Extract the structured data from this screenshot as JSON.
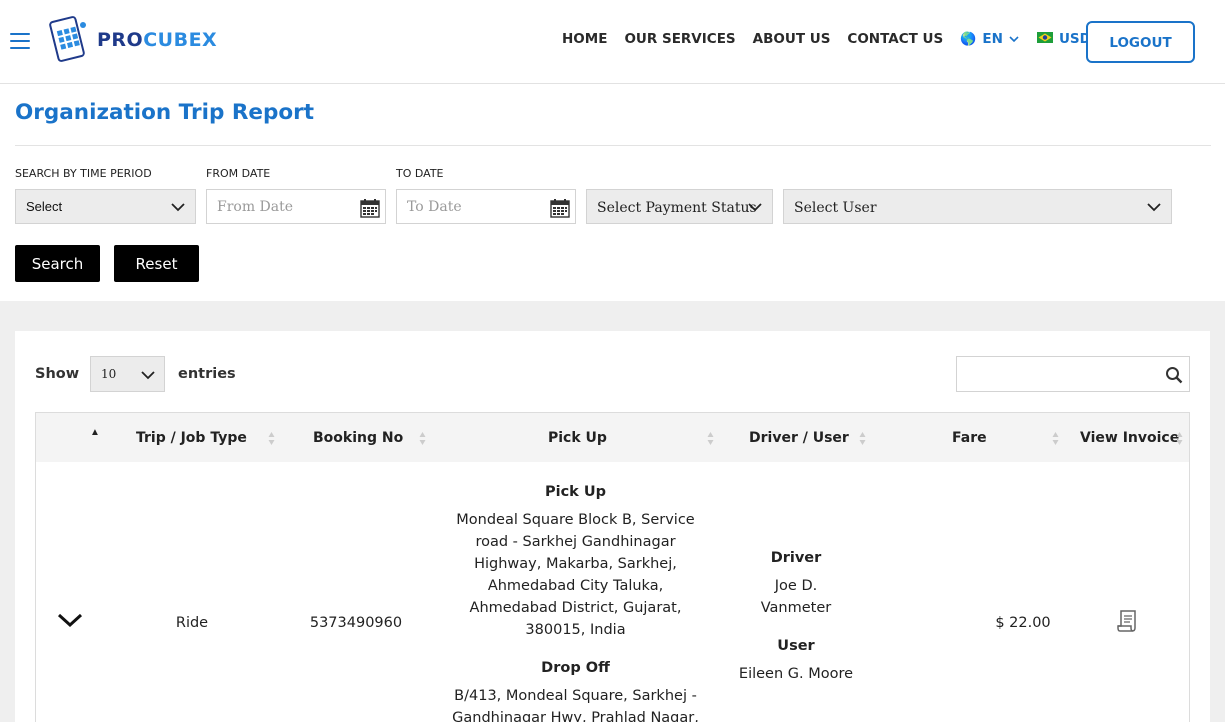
{
  "header": {
    "brand_part1": "PRO",
    "brand_part2": "CUBEX",
    "nav": [
      "HOME",
      "OUR SERVICES",
      "ABOUT US",
      "CONTACT US"
    ],
    "language": "EN",
    "currency": "USD",
    "logout_label": "LOGOUT"
  },
  "page": {
    "title": "Organization Trip Report"
  },
  "filters": {
    "time_period_label": "SEARCH BY TIME PERIOD",
    "time_period_value": "Select",
    "from_date_label": "FROM DATE",
    "from_date_placeholder": "From Date",
    "to_date_label": "TO DATE",
    "to_date_placeholder": "To Date",
    "payment_status": "Select Payment Status",
    "user": "Select User",
    "search_label": "Search",
    "reset_label": "Reset"
  },
  "table_controls": {
    "show_label": "Show",
    "entries_value": "10",
    "entries_label": "entries"
  },
  "table": {
    "columns": [
      "Trip / Job Type",
      "Booking No",
      "Pick Up",
      "Driver / User",
      "Fare",
      "View Invoice"
    ],
    "rows": [
      {
        "type": "Ride",
        "booking_no": "5373490960",
        "pickup_heading": "Pick Up",
        "pickup_lines": [
          "Mondeal Square Block B, Service",
          "road - Sarkhej Gandhinagar",
          "Highway, Makarba, Sarkhej,",
          "Ahmedabad City Taluka,",
          "Ahmedabad District, Gujarat,",
          "380015, India"
        ],
        "dropoff_heading": "Drop Off",
        "dropoff_lines": [
          "B/413, Mondeal Square, Sarkhej -",
          "Gandhinagar Hwy, Prahlad Nagar,"
        ],
        "driver_heading": "Driver",
        "driver_lines": [
          "Joe D.",
          "Vanmeter"
        ],
        "user_heading": "User",
        "user_name": "Eileen G. Moore",
        "fare": "$ 22.00"
      }
    ]
  },
  "colors": {
    "accent": "#1a73c9",
    "dark": "#000000",
    "panel": "#efefef"
  },
  "icons": [
    "menu-icon",
    "globe-icon",
    "flag-icon",
    "chevron-down-icon",
    "calendar-icon",
    "search-icon",
    "sort-icon",
    "invoice-icon"
  ]
}
